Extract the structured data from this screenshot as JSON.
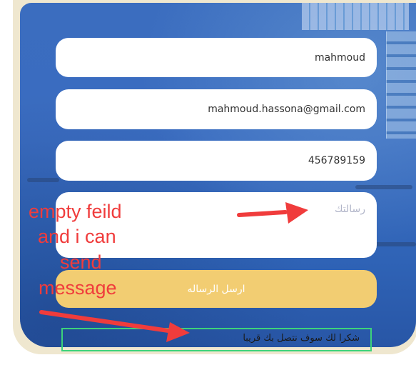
{
  "form": {
    "name_value": "mahmoud",
    "email_value": "mahmoud.hassona@gmail.com",
    "phone_value": "456789159",
    "message_placeholder": "رسالتك",
    "send_label": "ارسل الرساله"
  },
  "confirmation": {
    "text": "شكرا لك سوف نتصل بك قريبا"
  },
  "annotation": {
    "line1": "empty feild",
    "line2": "and i can",
    "line3": "send",
    "line4": "message"
  },
  "colors": {
    "panel": "#3a6cc0",
    "send_button": "#f2cd72",
    "annotation": "#f03c3c",
    "highlight_box": "#3dd37a"
  }
}
